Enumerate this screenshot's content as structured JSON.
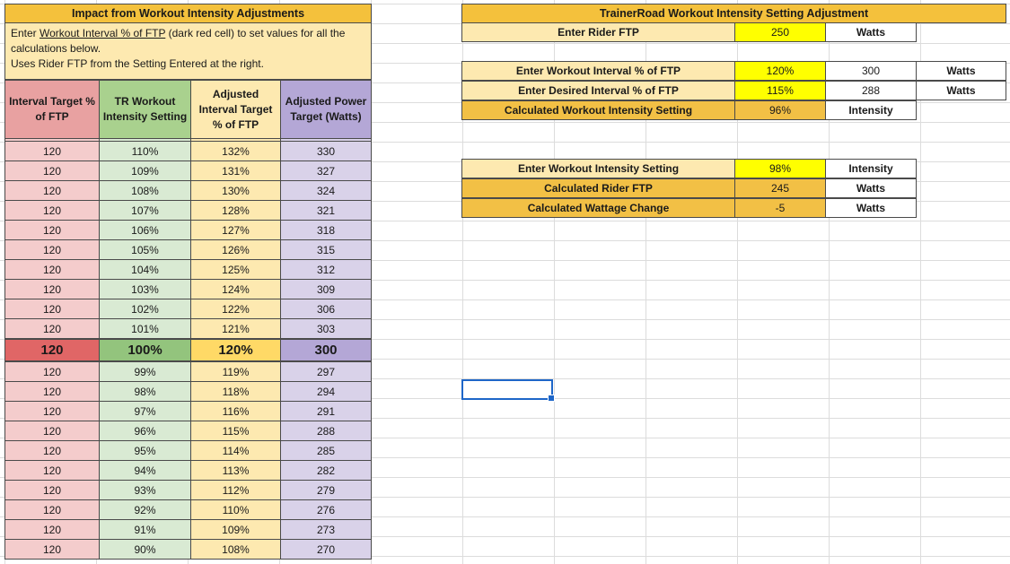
{
  "left": {
    "title": "Impact from Workout Intensity Adjustments",
    "instr_pre": "Enter ",
    "instr_link": "Workout Interval % of FTP",
    "instr_post": " (dark red cell) to set values for all the calculations below.",
    "instr_line2": "Uses Rider FTP from the Setting Entered at the right.",
    "headers": [
      "Interval Target % of FTP",
      "TR Workout Intensity Setting",
      "Adjusted Interval Target % of FTP",
      "Adjusted Power Target (Watts)"
    ],
    "rows": [
      [
        "120",
        "110%",
        "132%",
        "330"
      ],
      [
        "120",
        "109%",
        "131%",
        "327"
      ],
      [
        "120",
        "108%",
        "130%",
        "324"
      ],
      [
        "120",
        "107%",
        "128%",
        "321"
      ],
      [
        "120",
        "106%",
        "127%",
        "318"
      ],
      [
        "120",
        "105%",
        "126%",
        "315"
      ],
      [
        "120",
        "104%",
        "125%",
        "312"
      ],
      [
        "120",
        "103%",
        "124%",
        "309"
      ],
      [
        "120",
        "102%",
        "122%",
        "306"
      ],
      [
        "120",
        "101%",
        "121%",
        "303"
      ],
      [
        "120",
        "100%",
        "120%",
        "300"
      ],
      [
        "120",
        "99%",
        "119%",
        "297"
      ],
      [
        "120",
        "98%",
        "118%",
        "294"
      ],
      [
        "120",
        "97%",
        "116%",
        "291"
      ],
      [
        "120",
        "96%",
        "115%",
        "288"
      ],
      [
        "120",
        "95%",
        "114%",
        "285"
      ],
      [
        "120",
        "94%",
        "113%",
        "282"
      ],
      [
        "120",
        "93%",
        "112%",
        "279"
      ],
      [
        "120",
        "92%",
        "110%",
        "276"
      ],
      [
        "120",
        "91%",
        "109%",
        "273"
      ],
      [
        "120",
        "90%",
        "108%",
        "270"
      ]
    ],
    "highlight_index": 10
  },
  "right": {
    "title": "TrainerRoad Workout Intensity Setting Adjustment",
    "ftp": {
      "label": "Enter Rider FTP",
      "value": "250",
      "unit": "Watts"
    },
    "interval": {
      "label": "Enter Workout Interval % of FTP",
      "value": "120%",
      "watts": "300",
      "unit": "Watts"
    },
    "desired": {
      "label": "Enter Desired Interval % of FTP",
      "value": "115%",
      "watts": "288",
      "unit": "Watts"
    },
    "calc_setting": {
      "label": "Calculated Workout Intensity Setting",
      "value": "96%",
      "unit": "Intensity"
    },
    "enter_setting": {
      "label": "Enter Workout Intensity Setting",
      "value": "98%",
      "unit": "Intensity"
    },
    "calc_ftp": {
      "label": "Calculated Rider FTP",
      "value": "245",
      "unit": "Watts"
    },
    "calc_change": {
      "label": "Calculated Wattage Change",
      "value": "-5",
      "unit": "Watts"
    }
  },
  "colors": {
    "header_orange": "#f4c13c",
    "cream": "#fde9b0",
    "input_yellow": "#ffff00",
    "gold": "#f2c045",
    "pink_header": "#e8a1a1",
    "green_header": "#a9d18e",
    "purple_header": "#b4a7d6",
    "selection_blue": "#1e66c8"
  }
}
